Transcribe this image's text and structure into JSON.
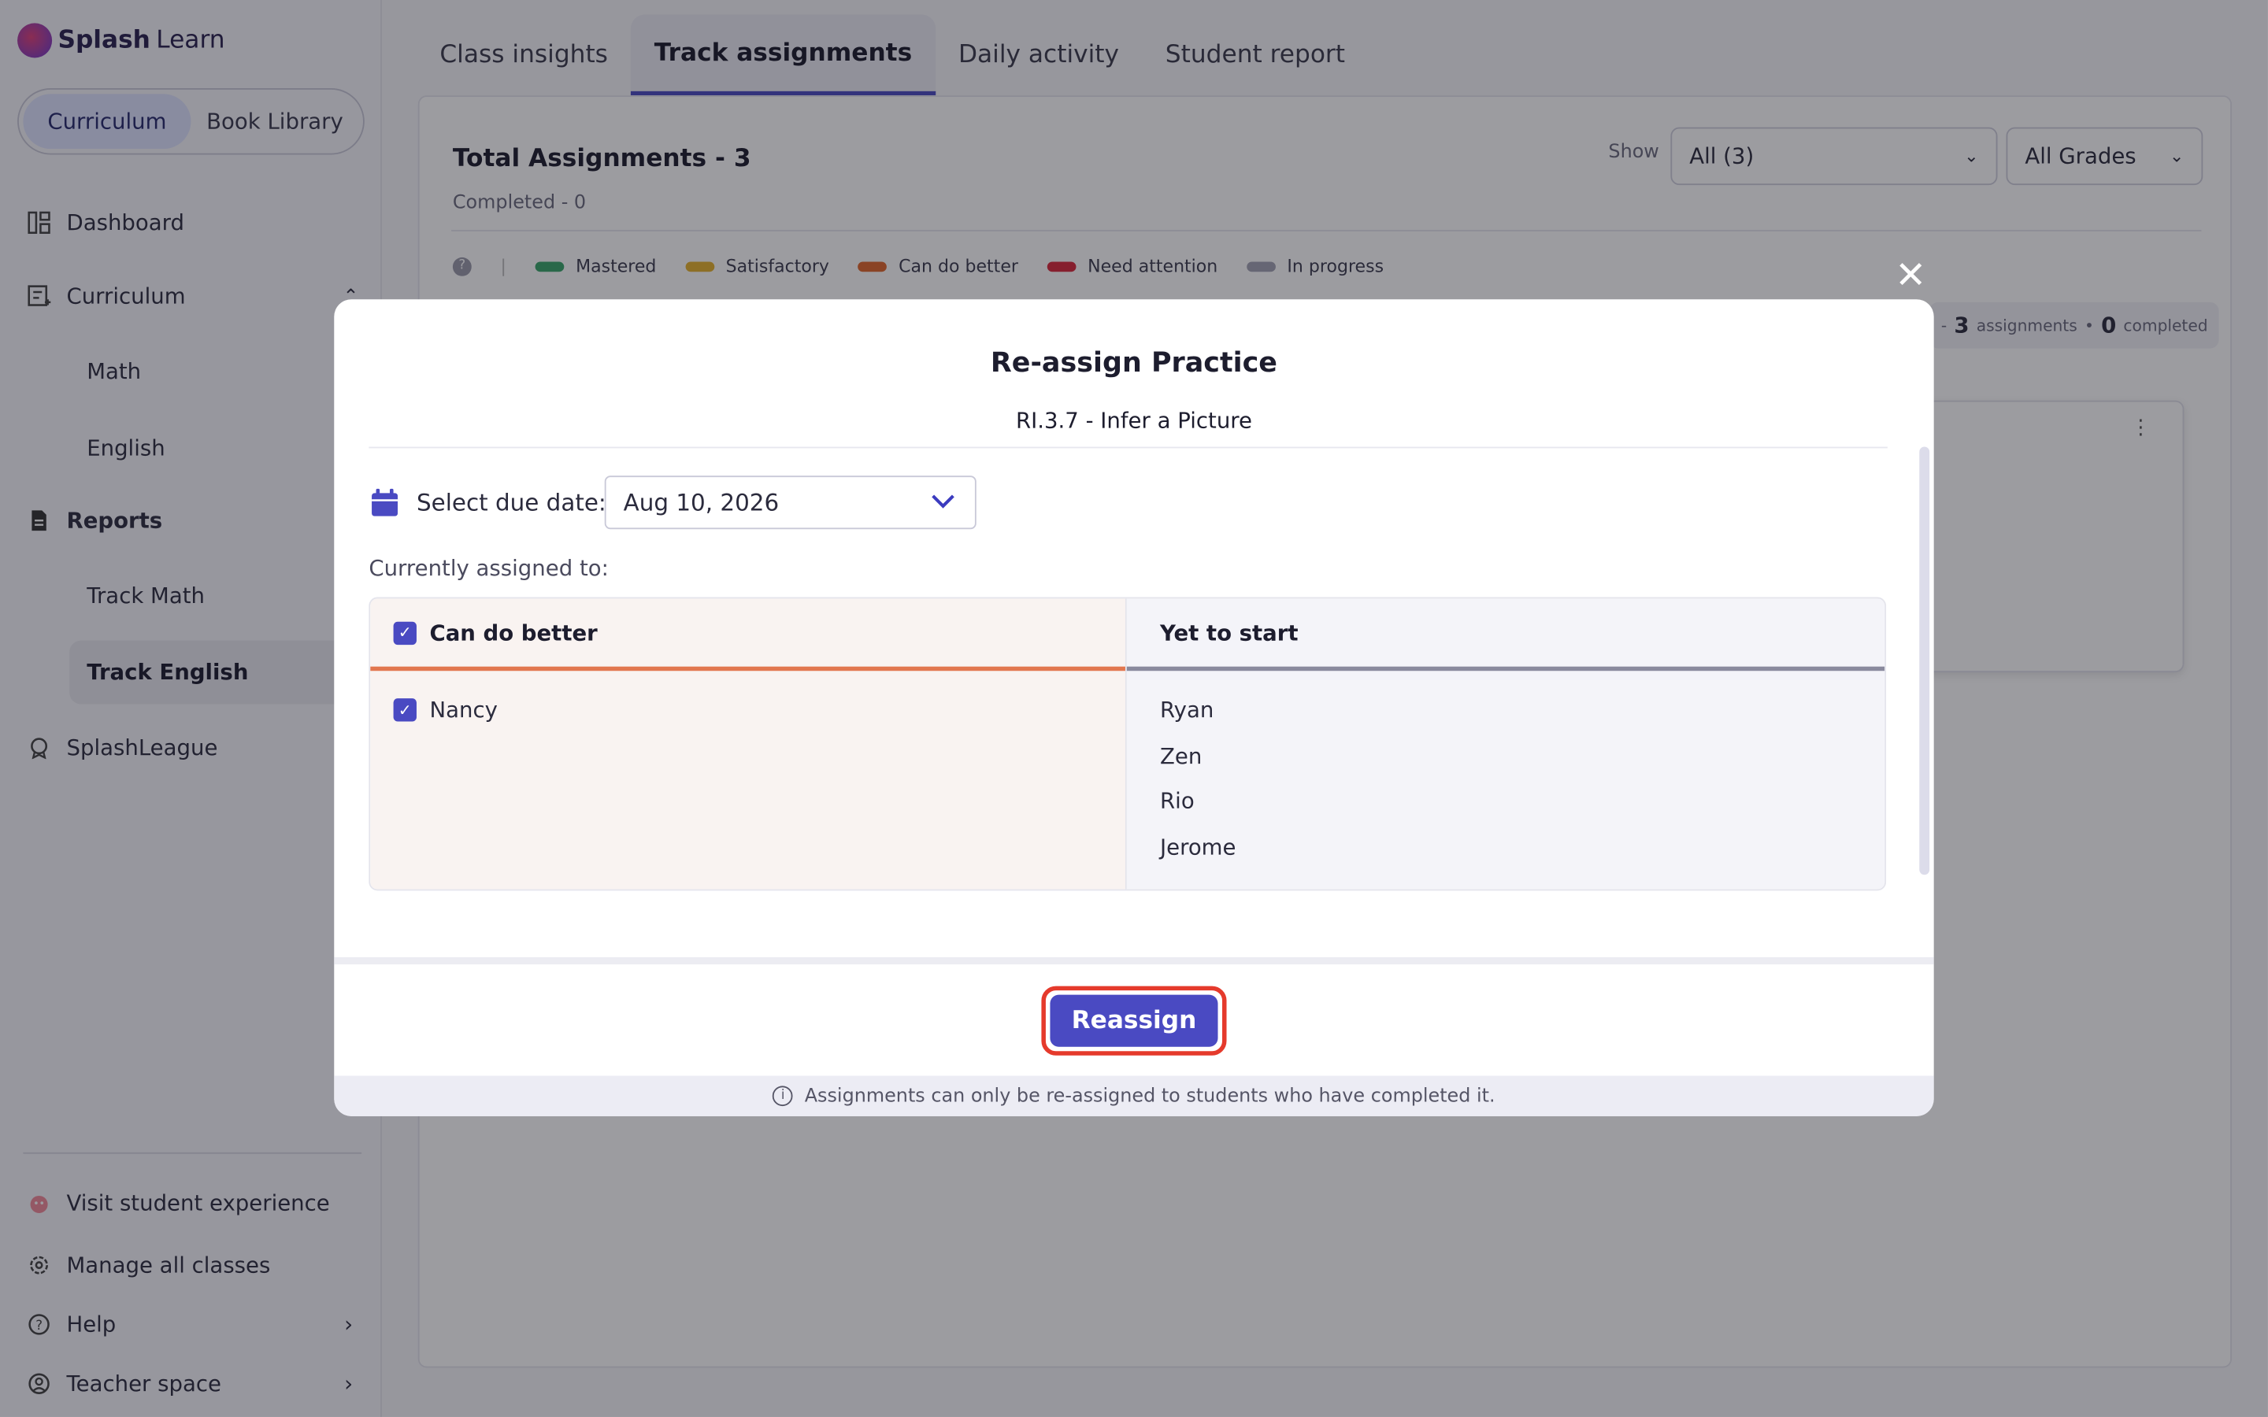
{
  "brand": {
    "name_bold": "Splash",
    "name_light": "Learn"
  },
  "segment": {
    "options": [
      "Curriculum",
      "Book Library"
    ],
    "active": "Curriculum"
  },
  "sidebar": {
    "dashboard": "Dashboard",
    "curriculum": "Curriculum",
    "curriculum_children": [
      "Math",
      "English"
    ],
    "reports": "Reports",
    "reports_children": [
      "Track Math",
      "Track English"
    ],
    "splashleague": "SplashLeague",
    "visit_student": "Visit student experience",
    "manage_classes": "Manage all classes",
    "help": "Help",
    "teacher_space": "Teacher space"
  },
  "tabs": [
    "Class insights",
    "Track assignments",
    "Daily activity",
    "Student report"
  ],
  "active_tab": "Track assignments",
  "report": {
    "total": "Total Assignments - 3",
    "completed": "Completed - 0",
    "show_label": "Show",
    "show_value": "All (3)",
    "grade_value": "All Grades",
    "legend": [
      {
        "label": "Mastered",
        "color": "#3aa66a"
      },
      {
        "label": "Satisfactory",
        "color": "#e6b12e"
      },
      {
        "label": "Can do better",
        "color": "#e0672c"
      },
      {
        "label": "Need attention",
        "color": "#d9283b"
      },
      {
        "label": "In progress",
        "color": "#a3a3b3"
      }
    ],
    "summary_assignments_count": "3",
    "summary_assignments_label": "assignments",
    "summary_completed_count": "0",
    "summary_completed_label": "completed"
  },
  "modal": {
    "title": "Re-assign Practice",
    "subtitle": "RI.3.7 - Infer a Picture",
    "due_label": "Select due date:",
    "due_value": "Aug 10, 2026",
    "currently_assigned": "Currently assigned to:",
    "col_a_header": "Can do better",
    "col_a_students": [
      "Nancy"
    ],
    "col_b_header": "Yet to start",
    "col_b_students": [
      "Ryan",
      "Zen",
      "Rio",
      "Jerome"
    ],
    "button": "Reassign",
    "footer_note": "Assignments can only be re-assigned to students who have completed it."
  },
  "colors": {
    "accent": "#4a4ac2",
    "highlight": "#e53a2c"
  }
}
